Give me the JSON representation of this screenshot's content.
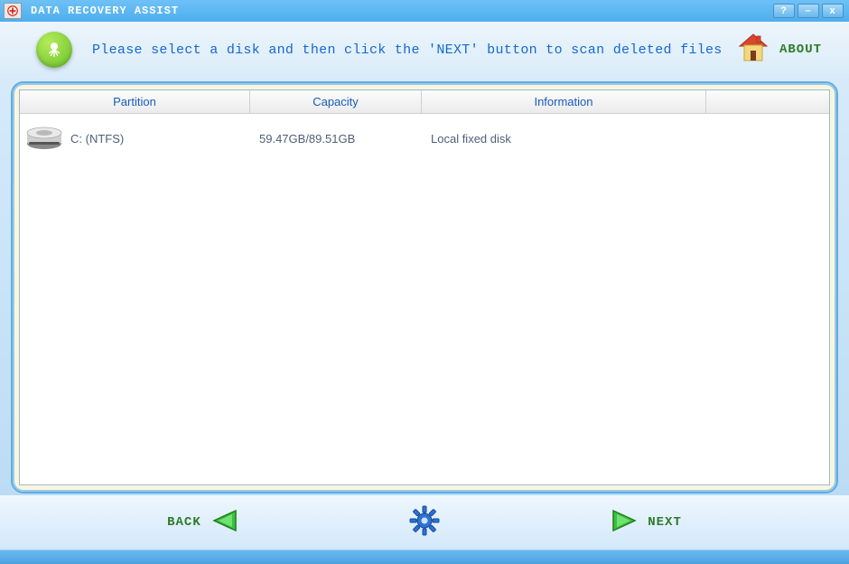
{
  "titlebar": {
    "title": "DATA RECOVERY ASSIST"
  },
  "header": {
    "instruction": "Please select a disk and then click the 'NEXT' button to scan deleted files",
    "about_label": "ABOUT"
  },
  "table": {
    "columns": {
      "partition": "Partition",
      "capacity": "Capacity",
      "information": "Information"
    },
    "rows": [
      {
        "partition": "C: (NTFS)",
        "capacity": "59.47GB/89.51GB",
        "information": "Local fixed disk"
      }
    ]
  },
  "footer": {
    "back_label": "BACK",
    "next_label": "NEXT"
  }
}
